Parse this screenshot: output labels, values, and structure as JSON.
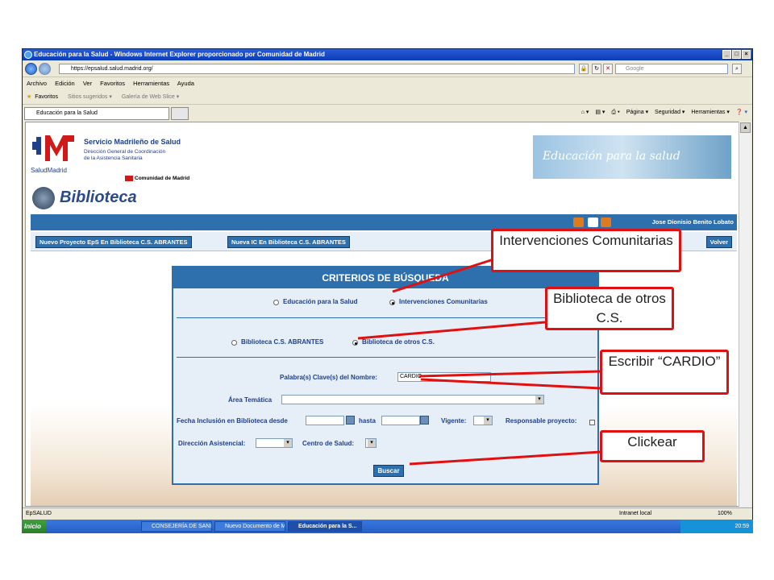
{
  "browser": {
    "title": "Educación para la Salud - Windows Internet Explorer proporcionado por Comunidad de Madrid",
    "url": "https://epsalud.salud.madrid.org/",
    "search_placeholder": "Google",
    "menu": [
      "Archivo",
      "Edición",
      "Ver",
      "Favoritos",
      "Herramientas",
      "Ayuda"
    ],
    "fav_label": "Favoritos",
    "fav_items": [
      "Sitios sugeridos ▾",
      "Galería de Web Slice ▾"
    ],
    "tab_label": "Educación para la Salud",
    "cmd": [
      "Página ▾",
      "Seguridad ▾",
      "Herramientas ▾"
    ],
    "status_left": "EpSALUD",
    "status_zone": "Intranet local",
    "zoom": "100%"
  },
  "header": {
    "brand": "Servicio Madrileño de Salud",
    "brand_sub": [
      "Dirección General de Coordinación",
      "de la Asistencia Sanitaria"
    ],
    "salud": "SaludMadrid",
    "comunidad": "Comunidad de Madrid",
    "banner": "Educación para la salud",
    "section_title": "Biblioteca",
    "user": "Jose Dionisio Benito Lobato"
  },
  "actions": {
    "new_project": "Nuevo Proyecto EpS En Biblioteca C.S. ABRANTES",
    "new_ic": "Nueva IC En Biblioteca C.S. ABRANTES",
    "back": "Volver"
  },
  "form": {
    "heading": "CRITERIOS DE BÚSQUEDA",
    "type_option_1": "Educación para la Salud",
    "type_option_2": "Intervenciones Comunitarias",
    "lib_option_1": "Biblioteca C.S. ABRANTES",
    "lib_option_2": "Biblioteca de otros C.S.",
    "keywords_label": "Palabra(s) Clave(s) del Nombre:",
    "keywords_value": "CARDIO",
    "area_label": "Área Temática",
    "fecha_label": "Fecha Inclusión en Biblioteca desde",
    "hasta_label": "hasta",
    "vigente_label": "Vigente:",
    "responsable_label": "Responsable proyecto:",
    "direccion_label": "Dirección Asistencial:",
    "centro_label": "Centro de Salud:",
    "submit": "Buscar"
  },
  "taskbar": {
    "start": "Inicio",
    "tasks": [
      "CONSEJERÍA DE SANID...",
      "Nuevo Documento de Mi...",
      "Educación para la S..."
    ],
    "clock": "20:59"
  },
  "callouts": {
    "c1": "Intervenciones Comunitarias",
    "c2": "Biblioteca de otros C.S.",
    "c3": "Escribir “CARDIO”",
    "c4": "Clickear"
  },
  "colors": {
    "accent": "#2e6fae",
    "callout": "#e01010"
  }
}
